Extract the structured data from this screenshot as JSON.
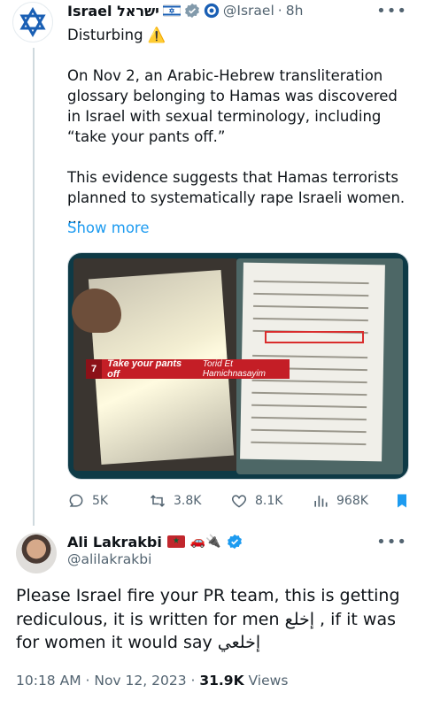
{
  "tweet1": {
    "author_name": "Israel ישראל",
    "handle": "@Israel",
    "separator": "·",
    "time": "8h",
    "more_label": "•••",
    "paragraphs": [
      "Disturbing ⚠️",
      "On Nov 2, an Arabic-Hebrew transliteration glossary belonging to Hamas was discovered in Israel with sexual terminology, including “take your pants off.”",
      "This evidence suggests that Hamas terrorists planned to systematically rape Israeli women.\n…"
    ],
    "show_more": "Show more",
    "media_caption": {
      "number": "7",
      "english": "Take your pants off",
      "transliteration": "Torid Et Hamichnasayim"
    },
    "stats": {
      "replies": "5K",
      "retweets": "3.8K",
      "likes": "8.1K",
      "views": "968K"
    }
  },
  "tweet2": {
    "author_name": "Ali Lakrakbi",
    "handle": "@alilakrakbi",
    "more_label": "•••",
    "emoji": "🚗🔌",
    "text": "Please Israel fire your PR team, this is getting rediculous, it is written for men إخلع , if it was for women it would say إخلعي",
    "meta_time": "10:18 AM · Nov 12, 2023 · ",
    "views_count": "31.9K",
    "views_label": " Views"
  },
  "colors": {
    "accent": "#1d9bf0",
    "text": "#0f1419",
    "muted": "#536471",
    "caption_red": "#c41e26"
  }
}
